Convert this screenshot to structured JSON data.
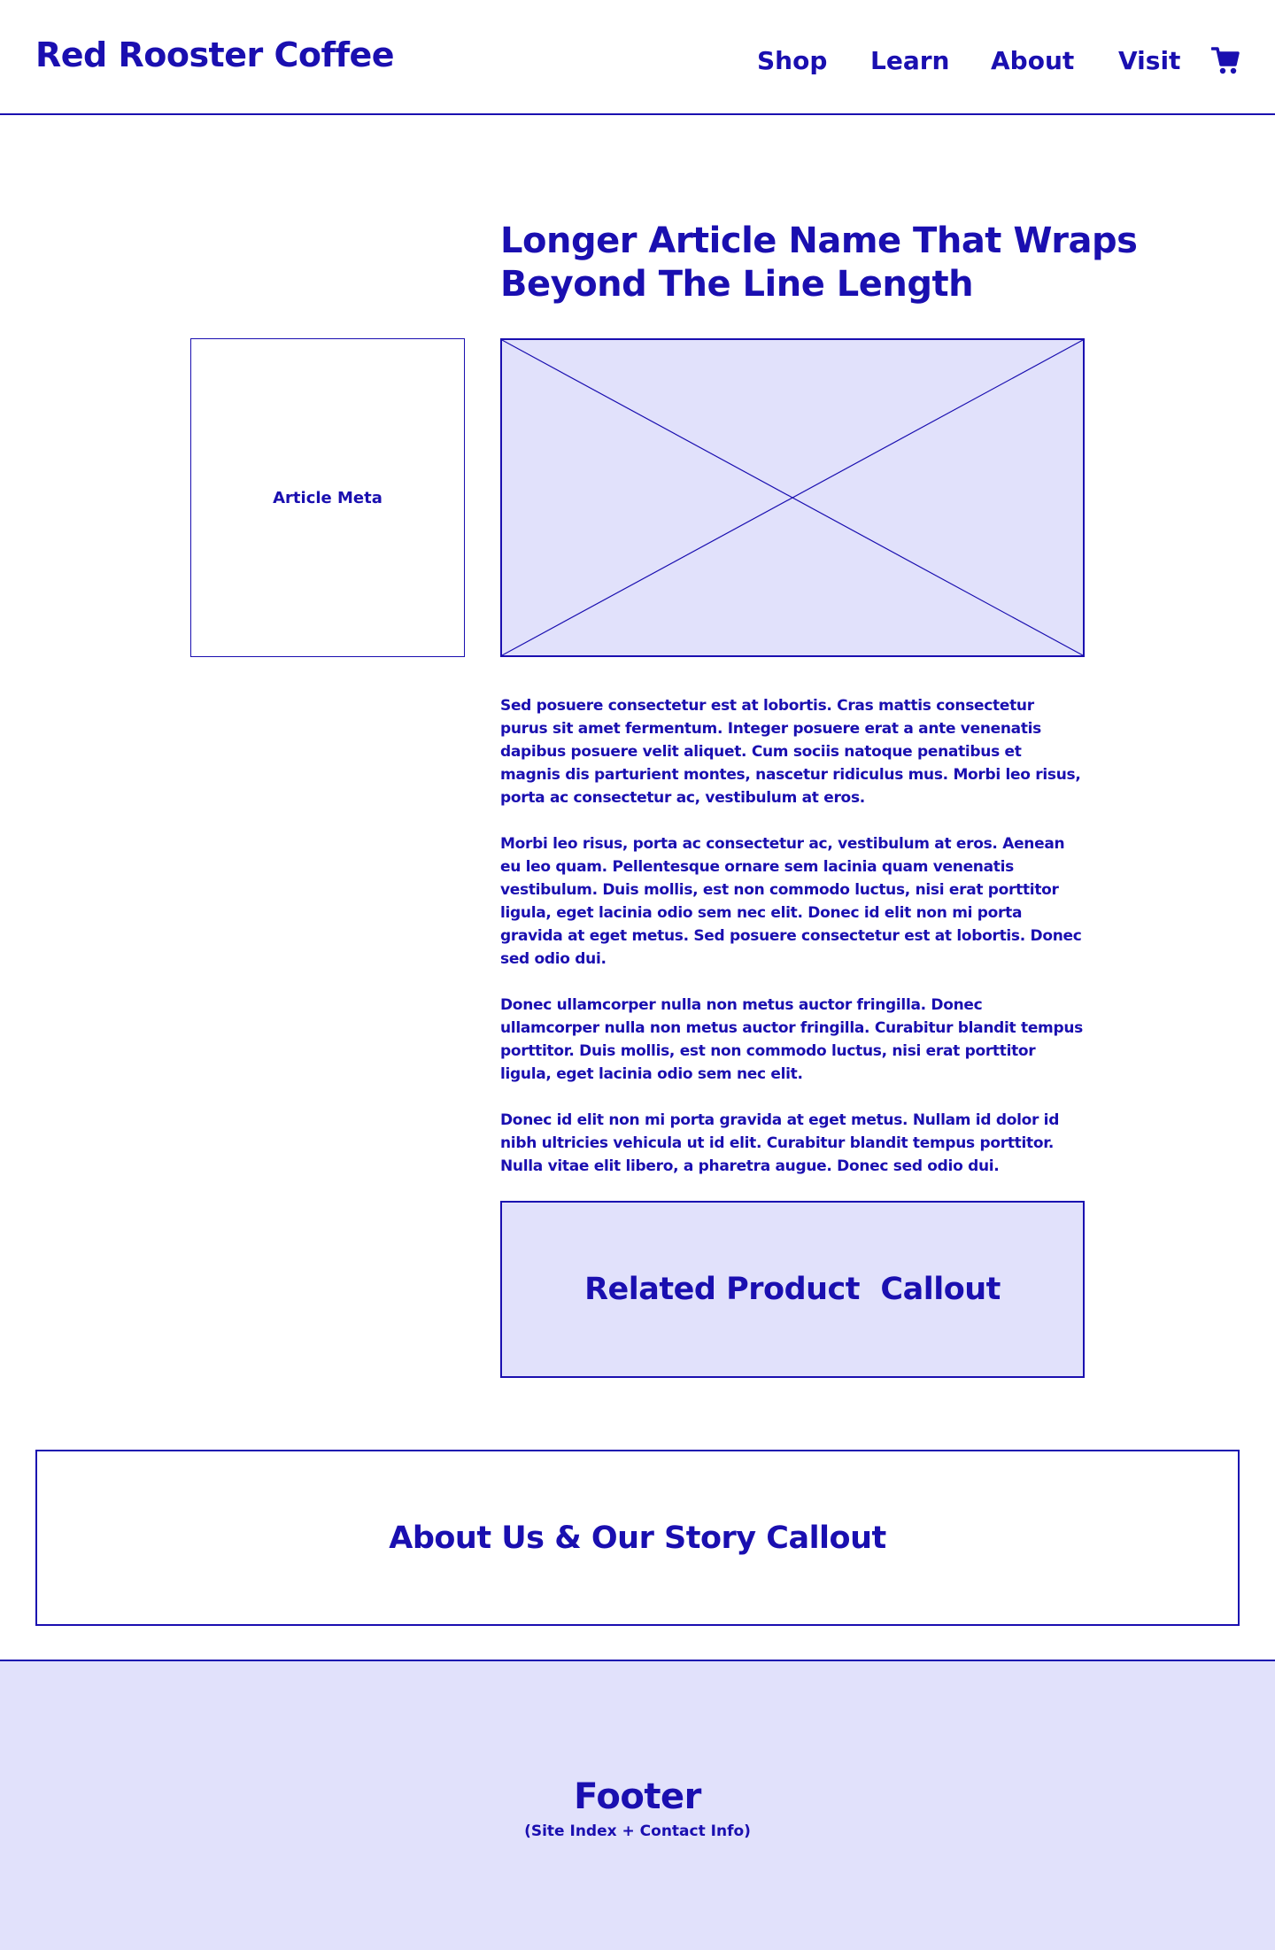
{
  "header": {
    "logo": "Red Rooster Coffee",
    "nav": {
      "shop": "Shop",
      "learn": "Learn",
      "about": "About",
      "visit": "Visit"
    },
    "cart_icon": "shopping-cart-icon"
  },
  "article": {
    "title": "Longer Article Name That Wraps Beyond The Line Length",
    "meta_label": "Article Meta",
    "hero_image": "image-placeholder",
    "paragraphs": [
      "Sed posuere consectetur est at lobortis. Cras mattis consectetur purus sit amet fermentum. Integer posuere erat a ante venenatis dapibus posuere velit aliquet. Cum sociis natoque penatibus et magnis dis parturient montes, nascetur ridiculus mus. Morbi leo risus, porta ac consectetur ac, vestibulum at eros.",
      "Morbi leo risus, porta ac consectetur ac, vestibulum at eros. Aenean eu leo quam. Pellentesque ornare sem lacinia quam venenatis vestibulum. Duis mollis, est non commodo luctus, nisi erat porttitor ligula, eget lacinia odio sem nec elit. Donec id elit non mi porta gravida at eget metus. Sed posuere consectetur est at lobortis. Donec sed odio dui.",
      "Donec ullamcorper nulla non metus auctor fringilla. Donec ullamcorper nulla non metus auctor fringilla. Curabitur blandit tempus porttitor. Duis mollis, est non commodo luctus, nisi erat porttitor ligula, eget lacinia odio sem nec elit.",
      "Donec id elit non mi porta gravida at eget metus. Nullam id dolor id nibh ultricies vehicula ut id elit. Curabitur blandit tempus porttitor. Nulla vitae elit libero, a pharetra augue. Donec sed odio dui."
    ]
  },
  "related_callout": "Related Product  Callout",
  "about_callout": "About Us & Our Story Callout",
  "footer": {
    "title": "Footer",
    "subtitle": "(Site Index + Contact Info)"
  },
  "colors": {
    "primary": "#1a0fb0",
    "fill": "#e1e1fb",
    "background": "#ffffff"
  }
}
